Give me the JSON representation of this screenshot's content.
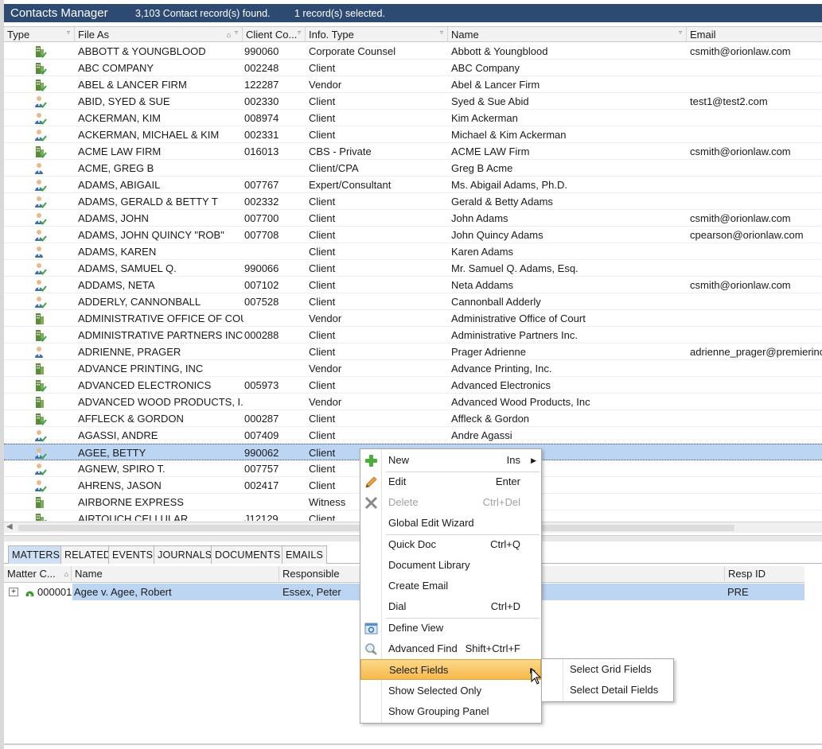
{
  "title_bar": {
    "app_title": "Contacts Manager",
    "found_text": "3,103 Contact record(s) found.",
    "selected_text": "1 record(s) selected."
  },
  "grid": {
    "columns": [
      "Type",
      "File As",
      "Client Co...",
      "Info. Type",
      "Name",
      "Email"
    ],
    "rows": [
      {
        "type": "org",
        "file_as": "ABBOTT & YOUNGBLOOD",
        "client_code": "990060",
        "info_type": "Corporate Counsel",
        "name": "Abbott & Youngblood",
        "email": "csmith@orionlaw.com"
      },
      {
        "type": "org",
        "file_as": "ABC COMPANY",
        "client_code": "002248",
        "info_type": "Client",
        "name": "ABC Company",
        "email": ""
      },
      {
        "type": "org",
        "file_as": "ABEL & LANCER FIRM",
        "client_code": "122287",
        "info_type": "Vendor",
        "name": "Abel & Lancer Firm",
        "email": ""
      },
      {
        "type": "person",
        "file_as": "ABID, SYED & SUE",
        "client_code": "002330",
        "info_type": "Client",
        "name": "Syed & Sue Abid",
        "email": "test1@test2.com"
      },
      {
        "type": "person",
        "file_as": "ACKERMAN, KIM",
        "client_code": "008974",
        "info_type": "Client",
        "name": "Kim Ackerman",
        "email": ""
      },
      {
        "type": "person",
        "file_as": "ACKERMAN, MICHAEL & KIM",
        "client_code": "002331",
        "info_type": "Client",
        "name": "Michael & Kim Ackerman",
        "email": ""
      },
      {
        "type": "org",
        "file_as": "ACME LAW FIRM",
        "client_code": "016013",
        "info_type": "CBS - Private",
        "name": "ACME LAW Firm",
        "email": "csmith@orionlaw.com"
      },
      {
        "type": "person-plain",
        "file_as": "ACME, GREG B",
        "client_code": "",
        "info_type": "Client/CPA",
        "name": "Greg B Acme",
        "email": ""
      },
      {
        "type": "person",
        "file_as": "ADAMS, ABIGAIL",
        "client_code": "007767",
        "info_type": "Expert/Consultant",
        "name": "Ms. Abigail Adams, Ph.D.",
        "email": ""
      },
      {
        "type": "person",
        "file_as": "ADAMS, GERALD & BETTY  T",
        "client_code": "002332",
        "info_type": "Client",
        "name": "Gerald & Betty Adams",
        "email": ""
      },
      {
        "type": "person",
        "file_as": "ADAMS, JOHN",
        "client_code": "007700",
        "info_type": "Client",
        "name": "John Adams",
        "email": "csmith@orionlaw.com"
      },
      {
        "type": "person",
        "file_as": "ADAMS, JOHN QUINCY \"ROB\"",
        "client_code": "007708",
        "info_type": "Client",
        "name": "John Quincy Adams",
        "email": "cpearson@orionlaw.com"
      },
      {
        "type": "person-plain",
        "file_as": "ADAMS, KAREN",
        "client_code": "",
        "info_type": "Client",
        "name": "Karen Adams",
        "email": ""
      },
      {
        "type": "person",
        "file_as": "ADAMS, SAMUEL Q.",
        "client_code": "990066",
        "info_type": "Client",
        "name": "Mr. Samuel Q. Adams, Esq.",
        "email": ""
      },
      {
        "type": "person",
        "file_as": "ADDAMS, NETA",
        "client_code": "007102",
        "info_type": "Client",
        "name": "Neta Addams",
        "email": "csmith@orionlaw.com"
      },
      {
        "type": "person",
        "file_as": "ADDERLY, CANNONBALL",
        "client_code": "007528",
        "info_type": "Client",
        "name": "Cannonball  Adderly",
        "email": ""
      },
      {
        "type": "org-plain",
        "file_as": "ADMINISTRATIVE OFFICE OF COU...",
        "client_code": "",
        "info_type": "Vendor",
        "name": "Administrative Office of Court",
        "email": ""
      },
      {
        "type": "org",
        "file_as": "ADMINISTRATIVE PARTNERS INC.",
        "client_code": "000288",
        "info_type": "Client",
        "name": "Administrative Partners Inc.",
        "email": ""
      },
      {
        "type": "person-plain",
        "file_as": "ADRIENNE, PRAGER",
        "client_code": "",
        "info_type": "Client",
        "name": "Prager Adrienne",
        "email": "adrienne_prager@premierinc"
      },
      {
        "type": "org-plain",
        "file_as": "ADVANCE PRINTING, INC",
        "client_code": "",
        "info_type": "Vendor",
        "name": "Advance Printing, Inc.",
        "email": ""
      },
      {
        "type": "org",
        "file_as": "ADVANCED ELECTRONICS",
        "client_code": "005973",
        "info_type": "Client",
        "name": "Advanced Electronics",
        "email": ""
      },
      {
        "type": "org-plain",
        "file_as": "ADVANCED WOOD PRODUCTS, I...",
        "client_code": "",
        "info_type": "Vendor",
        "name": "Advanced Wood Products, Inc",
        "email": ""
      },
      {
        "type": "org",
        "file_as": "AFFLECK & GORDON",
        "client_code": "000287",
        "info_type": "Client",
        "name": "Affleck & Gordon",
        "email": ""
      },
      {
        "type": "person",
        "file_as": "AGASSI, ANDRE",
        "client_code": "007409",
        "info_type": "Client",
        "name": "Andre Agassi",
        "email": ""
      },
      {
        "type": "person",
        "file_as": "AGEE, BETTY",
        "client_code": "990062",
        "info_type": "Client",
        "name": "",
        "email": ""
      },
      {
        "type": "person",
        "file_as": "AGNEW, SPIRO T.",
        "client_code": "007757",
        "info_type": "Client",
        "name": "",
        "email": ""
      },
      {
        "type": "person",
        "file_as": "AHRENS, JASON",
        "client_code": "002417",
        "info_type": "Client",
        "name": "",
        "email": ""
      },
      {
        "type": "org-plain",
        "file_as": "AIRBORNE EXPRESS",
        "client_code": "",
        "info_type": "Witness",
        "name": "",
        "email": ""
      },
      {
        "type": "org",
        "file_as": "AIRTOUCH CELLULAR",
        "client_code": "J12129",
        "info_type": "Client",
        "name": "",
        "email": ""
      }
    ]
  },
  "detail_tabs": [
    "MATTERS",
    "RELATED",
    "EVENTS",
    "JOURNALS",
    "DOCUMENTS",
    "EMAILS"
  ],
  "matters": {
    "columns": [
      "Matter C...",
      "Name",
      "Responsible",
      "Resp ID"
    ],
    "rows": [
      {
        "matter_code": "000001",
        "name": "Agee v. Agee, Robert",
        "responsible": "Essex, Peter",
        "resp_id": "PRE"
      }
    ]
  },
  "context_menu": {
    "items": [
      {
        "label": "New",
        "shortcut": "Ins",
        "submenu": true,
        "icon": "plus-icon"
      },
      {
        "label": "Edit",
        "shortcut": "Enter",
        "icon": "pencil-icon"
      },
      {
        "label": "Delete",
        "shortcut": "Ctrl+Del",
        "disabled": true,
        "icon": "delete-x-icon"
      },
      {
        "label": "Global Edit Wizard",
        "shortcut": ""
      },
      {
        "label": "Quick Doc",
        "shortcut": "Ctrl+Q"
      },
      {
        "label": "Document Library",
        "shortcut": ""
      },
      {
        "label": "Create Email",
        "shortcut": ""
      },
      {
        "label": "Dial",
        "shortcut": "Ctrl+D"
      },
      {
        "label": "Define View",
        "shortcut": "",
        "icon": "define-view-icon"
      },
      {
        "label": "Advanced Find",
        "shortcut": "Shift+Ctrl+F",
        "icon": "magnifier-icon"
      },
      {
        "label": "Select Fields",
        "shortcut": "",
        "submenu": true,
        "highlighted": true
      },
      {
        "label": "Show Selected Only",
        "shortcut": ""
      },
      {
        "label": "Show Grouping Panel",
        "shortcut": ""
      }
    ],
    "submenu": [
      "Select Grid Fields",
      "Select Detail Fields"
    ]
  },
  "colors": {
    "title_bar": "#2d4a73",
    "selection": "#bcd5f3",
    "menu_highlight": "#f6b94a",
    "org_icon": "#5a8a3a",
    "person_icon": "#3e6fa8"
  }
}
